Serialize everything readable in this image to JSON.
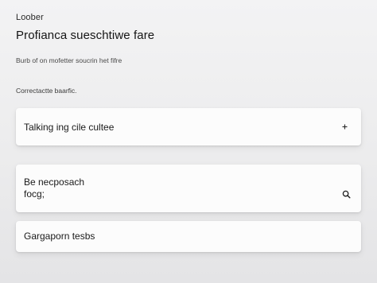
{
  "header": {
    "brand": "Loober",
    "title": "Profianca sueschtiwe fare",
    "subtitle": "Burb of on mofetter soucrin het fifre"
  },
  "section": {
    "label": "Correctactte baarfic."
  },
  "cards": [
    {
      "label": "Talking ing cile cultee",
      "icon": "plus-icon"
    },
    {
      "line1": "Be necposach",
      "line2": "focg;",
      "icon": "search-icon"
    },
    {
      "label": "Gargaporn tesbs"
    }
  ]
}
